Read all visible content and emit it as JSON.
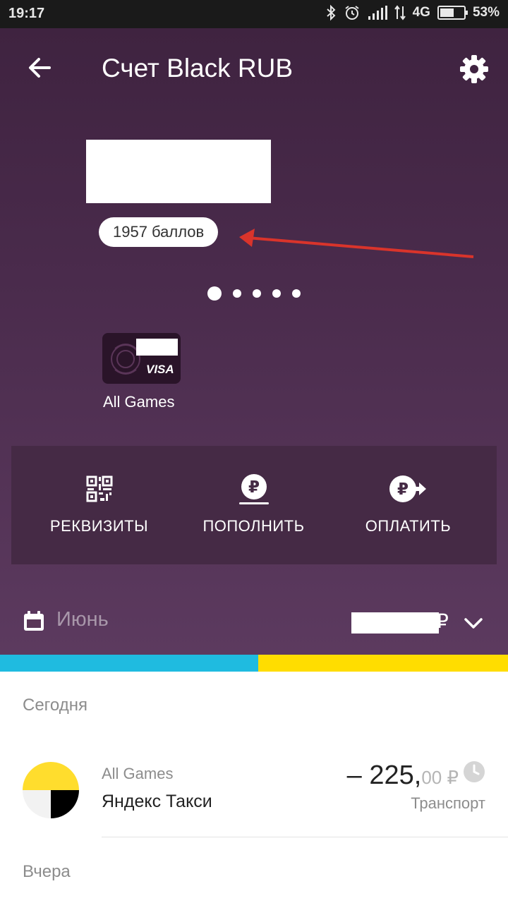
{
  "status_bar": {
    "time": "19:17",
    "network": "4G",
    "battery": "53%"
  },
  "header": {
    "title": "Счет Black RUB"
  },
  "account": {
    "points": "1957 баллов",
    "pager_pages": 5,
    "pager_active": 1
  },
  "card": {
    "brand": "VISA",
    "label": "All Games"
  },
  "actions": [
    {
      "label": "РЕКВИЗИТЫ",
      "icon": "qr-icon"
    },
    {
      "label": "ПОПОЛНИТЬ",
      "icon": "ruble-topup-icon"
    },
    {
      "label": "ОПЛАТИТЬ",
      "icon": "ruble-pay-icon"
    }
  ],
  "month": {
    "label": "Июнь",
    "currency": "₽"
  },
  "spend_bar": {
    "colors": [
      "#1fbbe0",
      "#ffdd00"
    ],
    "shares": [
      0.51,
      0.49
    ]
  },
  "sections": {
    "today": "Сегодня",
    "yesterday": "Вчера"
  },
  "transaction": {
    "card_name": "All Games",
    "merchant": "Яндекс Такси",
    "amount_main": "– 225,",
    "amount_cents": "00 ₽",
    "category": "Транспорт"
  },
  "colors": {
    "accent_purple": "#4a2b4c",
    "annotation_red": "#d9342b"
  }
}
